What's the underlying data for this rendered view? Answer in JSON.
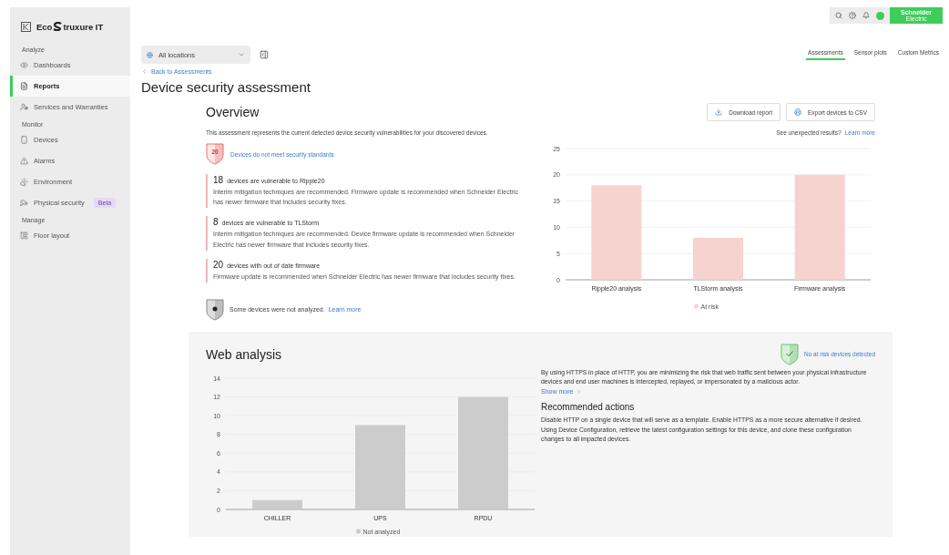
{
  "brand": {
    "before": "Eco",
    "after": "truxure IT"
  },
  "sidebar": {
    "sections": [
      {
        "label": "Analyze",
        "items": [
          {
            "label": "Dashboards",
            "selected": false
          },
          {
            "label": "Reports",
            "selected": true
          },
          {
            "label": "Services and Warranties",
            "selected": false
          }
        ]
      },
      {
        "label": "Monitor",
        "items": [
          {
            "label": "Devices",
            "selected": false
          },
          {
            "label": "Alarms",
            "selected": false
          },
          {
            "label": "Environment",
            "selected": false
          },
          {
            "label": "Physical security",
            "selected": false,
            "badge": "Beta"
          }
        ]
      },
      {
        "label": "Manage",
        "items": [
          {
            "label": "Floor layout",
            "selected": false
          }
        ]
      }
    ]
  },
  "header": {
    "logo": [
      "Schneider",
      "Electric"
    ]
  },
  "location_select": {
    "value": "All locations"
  },
  "tabs": [
    {
      "label": "Assessments",
      "selected": true
    },
    {
      "label": "Sensor plots",
      "selected": false
    },
    {
      "label": "Custom Metrics",
      "selected": false
    }
  ],
  "back_link": "Back to Assessments",
  "title": "Device security assessment",
  "overview": {
    "heading": "Overview",
    "buttons": [
      {
        "label": "Download report"
      },
      {
        "label": "Export devices to CSV"
      }
    ],
    "description": "This assessment represents the current detected device security vulnerabilities for your discovered devices.",
    "unexpected": {
      "text": "See unexpected results?",
      "link": "Learn more"
    },
    "risk_summary": {
      "count": "20",
      "link": "Devices do not meet security standards"
    },
    "findings": [
      {
        "count": "18",
        "title": "devices are vulnerable to Ripple20",
        "body": "Interim mitigation techniques are recommended. Firmware update is recommended when Schneider Electric has newer firmware that includes security fixes."
      },
      {
        "count": "8",
        "title": "devices are vulnerable to TLStorm",
        "body": "Interim mitigation techniques are recommended. Device firmware update is recommended when Schneider Electric has newer firmware that includes security fixes."
      },
      {
        "count": "20",
        "title": "devices with out of date firmware",
        "body": "Firmware update is recommended when Schneider Electric has newer firmware that includes security fixes."
      }
    ],
    "not_analyzed": {
      "text": "Some devices were not analyzed.",
      "link": "Learn more"
    },
    "chart_data": {
      "type": "bar",
      "categories": [
        "Ripple20 analysis",
        "TLStorm analysis",
        "Firmware analysis"
      ],
      "series": [
        {
          "name": "At risk",
          "color": "#f6d3cf",
          "values": [
            18,
            8,
            20
          ]
        }
      ],
      "ylim": [
        0,
        25
      ],
      "yticks": [
        0,
        5,
        10,
        15,
        20,
        25
      ],
      "grid": true
    }
  },
  "web_analysis": {
    "heading": "Web analysis",
    "status_link": "No at risk devices detected",
    "chart_data": {
      "type": "bar",
      "categories": [
        "CHILLER",
        "UPS",
        "RPDU"
      ],
      "series": [
        {
          "name": "Not analyzed",
          "color": "#cccccc",
          "values": [
            1,
            9,
            12
          ]
        }
      ],
      "ylim": [
        0,
        14
      ],
      "yticks": [
        0,
        2,
        4,
        6,
        8,
        10,
        12,
        14
      ],
      "grid": true
    },
    "description": "By using HTTPS in place of HTTP, you are minimizing the risk that web traffic sent between your physical infrastructure devices and end user machines is intercepted, replayed, or impersonated by a malicious actor.",
    "show_more": "Show more",
    "actions_heading": "Recommended actions",
    "actions_text": "Disable HTTP on a single device that will serve as a template. Enable HTTPS as a more secure alternative if desired. Using Device Configuration, retrieve the latest configuration settings for this device, and clone these configuration changes to all impacted devices."
  }
}
